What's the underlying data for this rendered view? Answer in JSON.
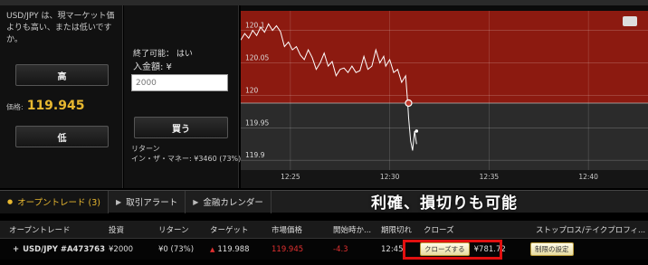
{
  "left": {
    "question": "USD/JPY は、現マーケット価よりも高い、または低いですか。",
    "high_label": "高",
    "low_label": "低",
    "price_label": "価格:",
    "price_value": "119.945"
  },
  "middle": {
    "end_possible": "終了可能： はい",
    "deposit": "入金額: ¥",
    "amount_placeholder": "2000",
    "buy_label": "買う",
    "return_label": "リターン",
    "in_the_money": "イン・ザ・マネー: ¥3460 (73%)"
  },
  "chart_data": {
    "type": "line",
    "x_ticks": [
      "12:25",
      "12:30",
      "12:35",
      "12:40"
    ],
    "y_ticks": [
      119.9,
      119.95,
      120,
      120.05,
      120.1
    ],
    "y_tick_labels": [
      "119.9",
      "119.95",
      "120",
      "120.05",
      "120.1"
    ],
    "ylim": [
      119.885,
      120.13
    ],
    "xlim_minutes": [
      22.5,
      43
    ],
    "strike": 119.988,
    "series": [
      {
        "x": [
          22.5,
          22.7,
          22.9,
          23.1,
          23.3,
          23.5,
          23.7,
          23.9,
          24.1,
          24.3,
          24.5,
          24.7,
          24.9,
          25.1,
          25.3,
          25.5,
          25.7,
          25.9,
          26.1,
          26.3,
          26.5,
          26.7,
          26.9,
          27.1,
          27.3,
          27.5,
          27.7,
          27.9,
          28.1,
          28.3,
          28.5,
          28.7,
          28.9,
          29.1,
          29.3,
          29.5,
          29.7,
          29.8,
          30.0,
          30.2,
          30.4,
          30.6,
          30.8,
          30.9,
          30.95,
          31.05,
          31.15,
          31.25,
          31.35
        ],
        "y": [
          120.085,
          120.095,
          120.088,
          120.1,
          120.092,
          120.105,
          120.097,
          120.11,
          120.1,
          120.107,
          120.098,
          120.075,
          120.082,
          120.07,
          120.075,
          120.062,
          120.055,
          120.07,
          120.058,
          120.04,
          120.05,
          120.065,
          120.045,
          120.052,
          120.03,
          120.04,
          120.042,
          120.035,
          120.045,
          120.035,
          120.038,
          120.06,
          120.04,
          120.045,
          120.07,
          120.05,
          120.06,
          120.045,
          120.055,
          120.035,
          120.04,
          120.02,
          120.03,
          119.99,
          119.965,
          119.93,
          119.915,
          119.945,
          119.925
        ]
      }
    ],
    "entry_point": {
      "x": 30.95,
      "y": 119.988
    },
    "end_point": {
      "x": 31.35,
      "y": 119.945
    },
    "colors": {
      "above": "#8c1a10",
      "below": "#2b2b2b",
      "line": "#ffffff"
    }
  },
  "tabs": [
    {
      "label": "オープントレード (3)"
    },
    {
      "label": "取引アラート"
    },
    {
      "label": "金融カレンダー"
    }
  ],
  "caption": "利確、損切りも可能",
  "table": {
    "headers": [
      "オープントレード",
      "投資",
      "リターン",
      "ターゲット",
      "市場価格",
      "開始時か...",
      "期限切れ",
      "クローズ",
      "ストップロス/テイクプロフィ..."
    ],
    "row": {
      "symbol": "USD/JPY #A473763",
      "investment": "¥2000",
      "return": "¥0 (73%)",
      "target": "119.988",
      "market": "119.945",
      "change": "-4.3",
      "expiry": "12:45",
      "close_button": "クローズする",
      "close_value": "¥781.72",
      "limit_button": "制限の設定"
    }
  }
}
